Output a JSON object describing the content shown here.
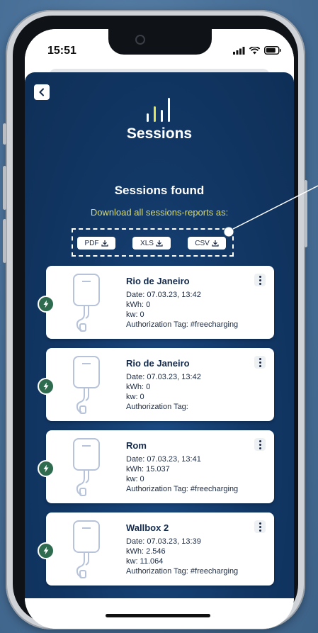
{
  "status_bar": {
    "time": "15:51"
  },
  "page": {
    "title": "Sessions"
  },
  "results": {
    "heading": "Sessions found",
    "download_label": "Download all sessions-reports as:",
    "formats": [
      "PDF",
      "XLS",
      "CSV"
    ]
  },
  "sessions": [
    {
      "name": "Rio de Janeiro",
      "date": "Date: 07.03.23, 13:42",
      "kwh": "kWh: 0",
      "kw": "kw: 0",
      "tag": "Authorization Tag: #freecharging"
    },
    {
      "name": "Rio de Janeiro",
      "date": "Date: 07.03.23, 13:42",
      "kwh": "kWh: 0",
      "kw": "kw: 0",
      "tag": "Authorization Tag:"
    },
    {
      "name": "Rom",
      "date": "Date: 07.03.23, 13:41",
      "kwh": "kWh: 15.037",
      "kw": "kw: 0",
      "tag": "Authorization Tag: #freecharging"
    },
    {
      "name": "Wallbox 2",
      "date": "Date: 07.03.23, 13:39",
      "kwh": "kWh: 2.546",
      "kw": "kw: 11.064",
      "tag": "Authorization Tag: #freecharging"
    }
  ],
  "colors": {
    "app_bg": "#123866",
    "accent_yellow": "#d8dc7a",
    "bolt_green": "#2f6b4e"
  }
}
